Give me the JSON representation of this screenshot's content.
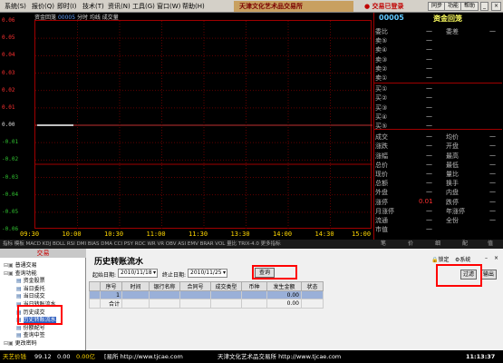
{
  "menubar": {
    "items": [
      "系统(S)",
      "报价(Q)",
      "即时(I)",
      "技术(T)",
      "资讯(N)",
      "工具(G)",
      "窗口(W)",
      "帮助(H)"
    ],
    "brand": "天津文化艺术品交易所",
    "trade_status": "交易已登录",
    "right_buttons": [
      "同步",
      "功能",
      "帮助"
    ]
  },
  "chart": {
    "title_prefix": "资金回笼",
    "code": "00005",
    "title_suffix": "分时 均线 成交量",
    "y_left": [
      "0.06",
      "0.05",
      "0.04",
      "0.03",
      "0.02",
      "0.01",
      "0.00",
      "-0.01",
      "-0.02",
      "-0.03",
      "-0.04",
      "-0.05",
      "-0.06"
    ],
    "y_right": [
      "600.0%",
      "500.0%",
      "400.0%",
      "300.0%",
      "200.0%",
      "100.0%",
      "0.0%",
      "100.0%",
      "200.0%",
      "300.0%",
      "400.0%",
      "500.0%",
      "600.0%"
    ],
    "x_labels": [
      "09:30",
      "10:00",
      "10:30",
      "11:00",
      "11:30",
      "13:30",
      "14:00",
      "14:30",
      "15:00"
    ],
    "indicator_tabs": "指标 模板 MACD KDJ BOLL RSI DMI BIAS DMA CCI PSY ROC WR VR OBV ASI EMV BRAR VOL 量比 TRIX-4.0 更多指标"
  },
  "quote": {
    "code": "00005",
    "name": "资金回笼",
    "rows_left": [
      "委比",
      "卖⑤",
      "卖④",
      "卖③",
      "卖②",
      "卖①",
      "买①",
      "买②",
      "买③",
      "买④",
      "买⑤",
      "成交",
      "涨跌",
      "涨幅",
      "总价",
      "现价",
      "总额",
      "外盘",
      "涨停",
      "月涨停",
      "流通",
      "市值"
    ],
    "rows_right": [
      "委差",
      "",
      "",
      "",
      "",
      "",
      "",
      "",
      "",
      "",
      "",
      "均价",
      "开盘",
      "最高",
      "最低",
      "量比",
      "换手",
      "内盘",
      "跌停",
      "年涨停",
      "全份",
      ""
    ],
    "dash": "—",
    "limit_value": "0.01",
    "tabs": [
      "笔",
      "价",
      "细",
      "配",
      "值"
    ]
  },
  "tree": {
    "header": "交易",
    "items": [
      {
        "label": "普通交易",
        "level": 0
      },
      {
        "label": "查询功能",
        "level": 0
      },
      {
        "label": "资金股票",
        "level": 1
      },
      {
        "label": "当日委托",
        "level": 1
      },
      {
        "label": "当日成交",
        "level": 1
      },
      {
        "label": "当日转账流水",
        "level": 1
      },
      {
        "label": "历史成交",
        "level": 1
      },
      {
        "label": "历史转账流水",
        "level": 1
      },
      {
        "label": "份额配号",
        "level": 1
      },
      {
        "label": "查询中签",
        "level": 1
      },
      {
        "label": "更改密码",
        "level": 0
      }
    ]
  },
  "panel": {
    "title": "历史转账流水",
    "tools": [
      "锁定",
      "系统"
    ],
    "start_label": "起始日期:",
    "start_date": "2010/11/18",
    "end_label": "终止日期:",
    "end_date": "2010/11/25",
    "query_button": "查询",
    "filter_button": "过滤",
    "export_button": "输出",
    "columns": [
      "序号",
      "时间",
      "银行名称",
      "合同号",
      "成交类型",
      "币种",
      "发生金额",
      "状态"
    ],
    "rows": [
      {
        "seq": "1",
        "amount": "0.00"
      },
      {
        "seq": "合计",
        "amount": "0.00"
      }
    ]
  },
  "status": {
    "index_name": "天艺价钱",
    "index_value": "99.12",
    "change": "0.00",
    "amount": "0.00亿",
    "ticker1": "[易所 http://www.tjcae.com",
    "ticker2": "天津文化艺术品交易所 http://www.tjcae.com",
    "time": "11:13:37"
  }
}
